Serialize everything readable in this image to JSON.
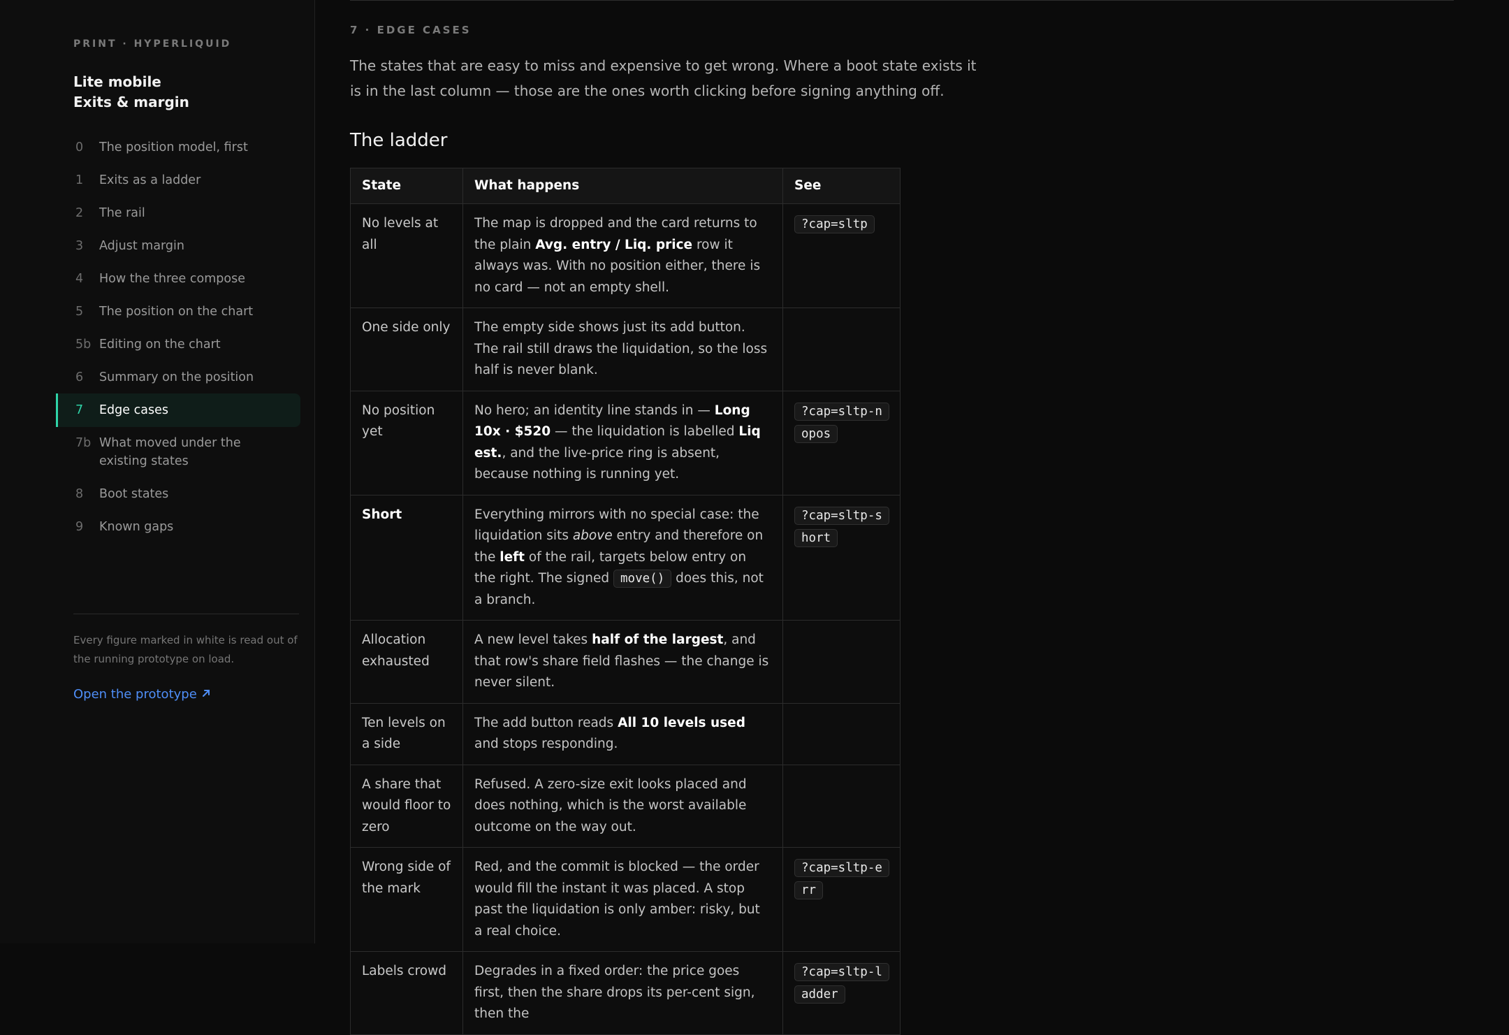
{
  "sidebar": {
    "brand": "PRINT · HYPERLIQUID",
    "title_line1": "Lite mobile",
    "title_line2": "Exits & margin",
    "nav": [
      {
        "num": "0",
        "label": "The position model, first"
      },
      {
        "num": "1",
        "label": "Exits as a ladder"
      },
      {
        "num": "2",
        "label": "The rail"
      },
      {
        "num": "3",
        "label": "Adjust margin"
      },
      {
        "num": "4",
        "label": "How the three compose"
      },
      {
        "num": "5",
        "label": "The position on the chart"
      },
      {
        "num": "5b",
        "label": "Editing on the chart"
      },
      {
        "num": "6",
        "label": "Summary on the position"
      },
      {
        "num": "7",
        "label": "Edge cases"
      },
      {
        "num": "7b",
        "label": "What moved under the existing states"
      },
      {
        "num": "8",
        "label": "Boot states"
      },
      {
        "num": "9",
        "label": "Known gaps"
      }
    ],
    "note": "Every figure marked in white is read out of the running prototype on load.",
    "link": "Open the prototype",
    "link_icon": "arrow-up-right-icon",
    "accent_color": "#2fd4a8",
    "link_color": "#4f8ef7"
  },
  "main": {
    "section_label": "7 · EDGE CASES",
    "intro": "The states that are easy to miss and expensive to get wrong. Where a boot state exists it is in the last column — those are the ones worth clicking before signing anything off.",
    "heading": "The ladder",
    "table": {
      "headers": [
        "State",
        "What happens",
        "See"
      ],
      "rows": [
        {
          "state": "No levels at all",
          "what": [
            "The map is dropped and the card returns to the plain ",
            {
              "b": "Avg. entry / Liq. price"
            },
            " row it always was. With no position either, there is no card — not an empty shell."
          ],
          "see": "?cap=sltp"
        },
        {
          "state": "One side only",
          "what": [
            "The empty side shows just its add button. The rail still draws the liquidation, so the loss half is never blank."
          ],
          "see": ""
        },
        {
          "state": "No position yet",
          "what": [
            "No hero; an identity line stands in — ",
            {
              "b": "Long 10x · $520"
            },
            " — the liquidation is labelled ",
            {
              "b": "Liq est."
            },
            ", and the live-price ring is absent, because nothing is running yet."
          ],
          "see": "?cap=sltp-nopos"
        },
        {
          "state": "Short",
          "state_bold": true,
          "what": [
            "Everything mirrors with no special case: the liquidation sits ",
            {
              "i": "above"
            },
            " entry and therefore on the ",
            {
              "b": "left"
            },
            " of the rail, targets below entry on the right. The signed ",
            {
              "code": "move()"
            },
            " does this, not a branch."
          ],
          "see": "?cap=sltp-short"
        },
        {
          "state": "Allocation exhausted",
          "what": [
            "A new level takes ",
            {
              "b": "half of the largest"
            },
            ", and that row's share field flashes — the change is never silent."
          ],
          "see": ""
        },
        {
          "state": "Ten levels on a side",
          "what": [
            "The add button reads ",
            {
              "b": "All 10 levels used"
            },
            " and stops responding."
          ],
          "see": ""
        },
        {
          "state": "A share that would floor to zero",
          "what": [
            "Refused. A zero-size exit looks placed and does nothing, which is the worst available outcome on the way out."
          ],
          "see": ""
        },
        {
          "state": "Wrong side of the mark",
          "what": [
            "Red, and the commit is blocked — the order would fill the instant it was placed. A stop past the liquidation is only amber: risky, but a real choice."
          ],
          "see": "?cap=sltp-err"
        },
        {
          "state": "Labels crowd",
          "what": [
            "Degrades in a fixed order: the price goes first, then the share drops its per-cent sign, then the"
          ],
          "see": "?cap=sltp-ladder"
        }
      ]
    }
  }
}
